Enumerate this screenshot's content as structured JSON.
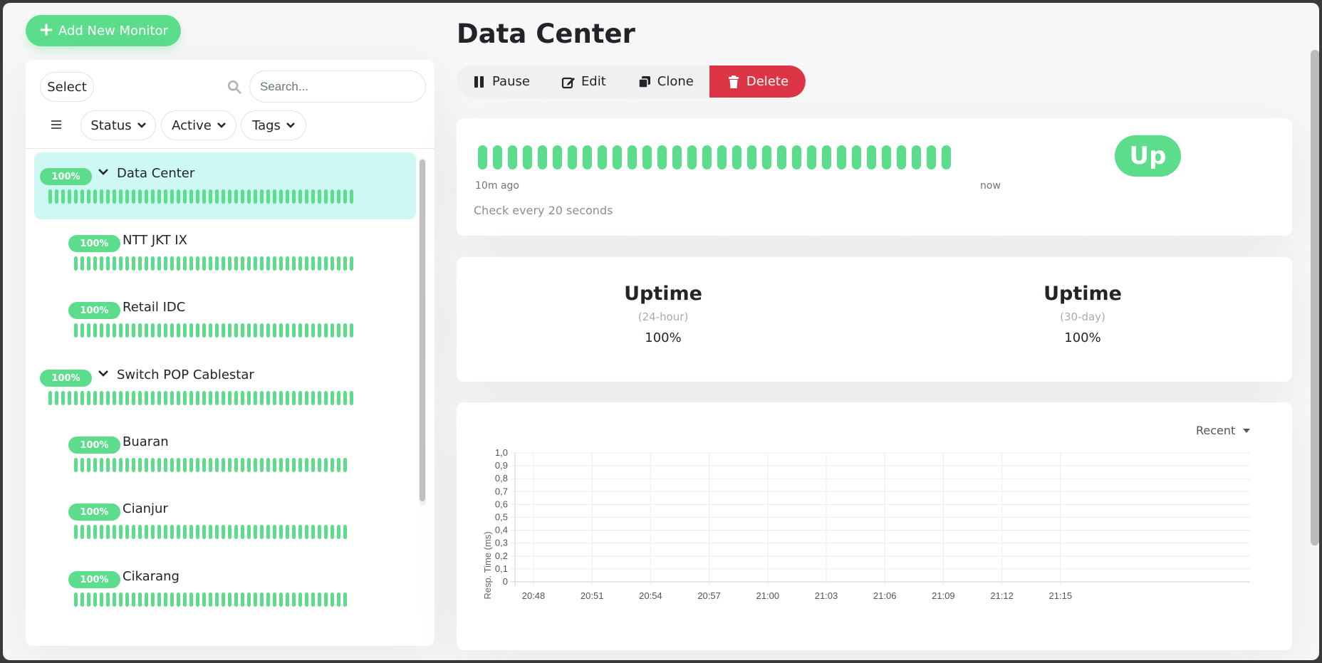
{
  "actions": {
    "add_monitor": "Add New Monitor"
  },
  "list": {
    "select_label": "Select",
    "search_placeholder": "Search...",
    "filters": {
      "status": "Status",
      "active": "Active",
      "tags": "Tags"
    },
    "items": [
      {
        "name": "Data Center",
        "uptime": "100%",
        "group": true,
        "selected": true
      },
      {
        "name": "NTT JKT IX",
        "uptime": "100%",
        "group": false
      },
      {
        "name": "Retail IDC",
        "uptime": "100%",
        "group": false
      },
      {
        "name": "Switch POP Cablestar",
        "uptime": "100%",
        "group": true
      },
      {
        "name": "Buaran",
        "uptime": "100%",
        "group": false
      },
      {
        "name": "Cianjur",
        "uptime": "100%",
        "group": false
      },
      {
        "name": "Cikarang",
        "uptime": "100%",
        "group": false
      }
    ]
  },
  "detail": {
    "title": "Data Center",
    "buttons": {
      "pause": "Pause",
      "edit": "Edit",
      "clone": "Clone",
      "delete": "Delete"
    },
    "heartbeat": {
      "start_label": "10m ago",
      "end_label": "now",
      "check_interval": "Check every 20 seconds",
      "status": "Up"
    },
    "uptime": [
      {
        "title": "Uptime",
        "period": "(24-hour)",
        "value": "100%"
      },
      {
        "title": "Uptime",
        "period": "(30-day)",
        "value": "100%"
      }
    ],
    "chart_range": "Recent"
  },
  "colors": {
    "up": "#5cdd8b",
    "delete": "#dc3545",
    "selected_row": "#cdf8f4"
  },
  "chart_data": {
    "type": "line",
    "title": "",
    "xlabel": "",
    "ylabel": "Resp. Time (ms)",
    "x_ticks": [
      "20:48",
      "20:51",
      "20:54",
      "20:57",
      "21:00",
      "21:03",
      "21:06",
      "21:09",
      "21:12",
      "21:15"
    ],
    "y_ticks": [
      "0",
      "0,1",
      "0,2",
      "0,3",
      "0,4",
      "0,5",
      "0,6",
      "0,7",
      "0,8",
      "0,9",
      "1,0"
    ],
    "ylim": [
      0,
      1.0
    ],
    "grid": true,
    "series": []
  }
}
